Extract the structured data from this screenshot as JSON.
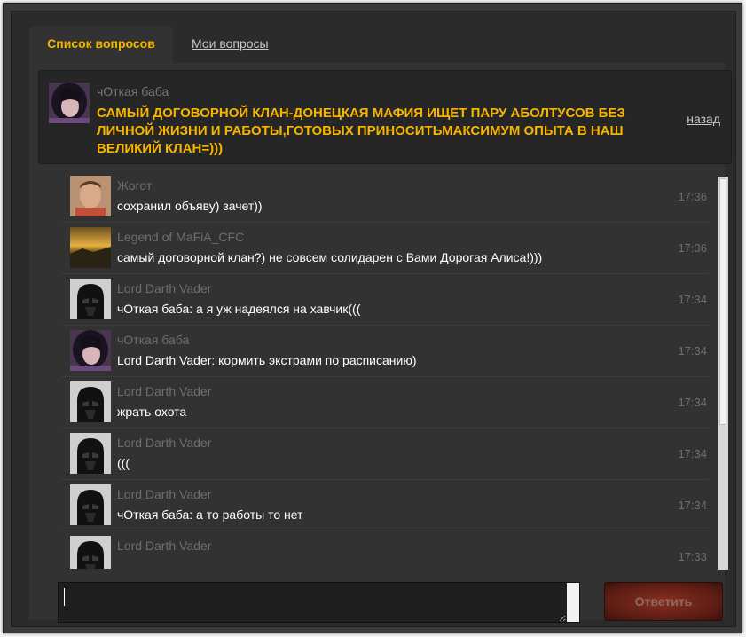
{
  "window": {
    "close_label": "✕"
  },
  "tabs": [
    {
      "label": "Список вопросов",
      "active": true
    },
    {
      "label": "Мои вопросы",
      "active": false
    }
  ],
  "question": {
    "author": "чОткая баба",
    "text": "САМЫЙ ДОГОВОРНОЙ КЛАН-ДОНЕЦКАЯ МАФИЯ ИЩЕТ ПАРУ АБОЛТУСОВ БЕЗ ЛИЧНОЙ ЖИЗНИ И РАБОТЫ,ГОТОВЫХ ПРИНОСИТЬМАКСИМУМ ОПЫТА В НАШ ВЕЛИКИЙ КЛАН=)))",
    "back_label": "назад"
  },
  "messages": [
    {
      "author": "Жогот",
      "text": "сохранил объяву) зачет))",
      "time": "17:36",
      "avatar": "man"
    },
    {
      "author": "Legend of MaFiA_CFC",
      "text": "самый договорной клан?) не совсем солидарен с Вами Дорогая Алиса!)))",
      "time": "17:36",
      "avatar": "landscape"
    },
    {
      "author": "Lord Darth Vader",
      "text": "чОткая баба: а я уж надеялся на хавчик(((",
      "time": "17:34",
      "avatar": "vader"
    },
    {
      "author": "чОткая баба",
      "text": "Lord Darth Vader: кормить экстрами по расписанию)",
      "time": "17:34",
      "avatar": "woman"
    },
    {
      "author": "Lord Darth Vader",
      "text": "жрать охота",
      "time": "17:34",
      "avatar": "vader"
    },
    {
      "author": "Lord Darth Vader",
      "text": "(((",
      "time": "17:34",
      "avatar": "vader"
    },
    {
      "author": "Lord Darth Vader",
      "text": "чОткая баба: а то работы то нет",
      "time": "17:34",
      "avatar": "vader"
    },
    {
      "author": "Lord Darth Vader",
      "text": "",
      "time": "17:33",
      "avatar": "vader"
    }
  ],
  "reply": {
    "input_value": "",
    "button_label": "Ответить"
  },
  "colors": {
    "accent": "#f7b500",
    "background": "#2b2b2b",
    "button": "#5b1d14"
  }
}
